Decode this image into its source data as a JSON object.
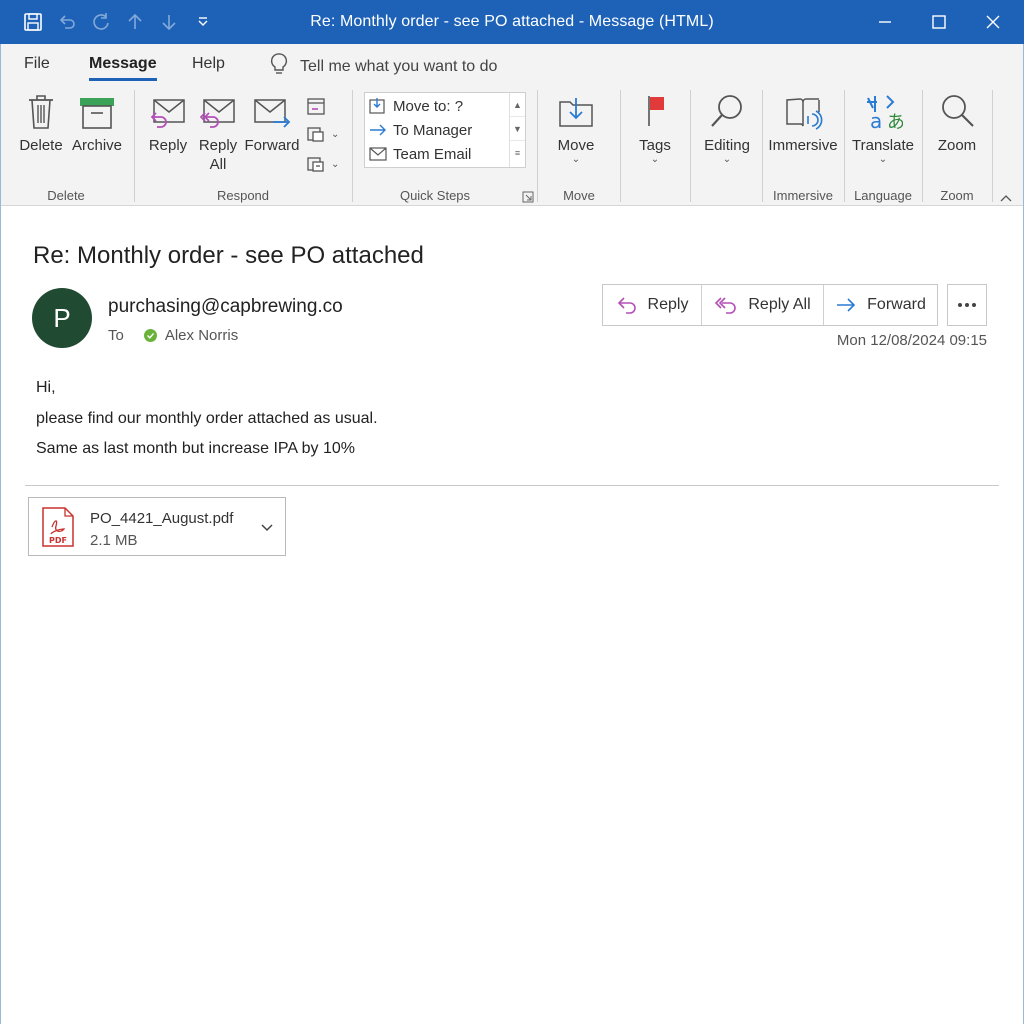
{
  "window": {
    "title": "Re: Monthly order - see PO attached  - Message (HTML)",
    "accent": "#1e62b8"
  },
  "menu": {
    "tabs": [
      "File",
      "Message",
      "Help"
    ],
    "active_tab": "Message",
    "tell_me": "Tell me what you want to do"
  },
  "ribbon": {
    "delete_group": {
      "label": "Delete",
      "delete": "Delete",
      "archive": "Archive"
    },
    "respond_group": {
      "label": "Respond",
      "reply": "Reply",
      "reply_all_1": "Reply",
      "reply_all_2": "All",
      "forward": "Forward"
    },
    "quick_steps": {
      "label": "Quick Steps",
      "items": [
        "Move to: ?",
        "To Manager",
        "Team Email"
      ]
    },
    "move_group": {
      "label": "Move",
      "move": "Move"
    },
    "tags": {
      "label": "Tags"
    },
    "editing": {
      "label": "Editing"
    },
    "immersive_group": {
      "label": "Immersive",
      "button": "Immersive"
    },
    "language_group": {
      "label": "Language",
      "button": "Translate"
    },
    "zoom_group": {
      "label": "Zoom",
      "button": "Zoom"
    }
  },
  "message": {
    "subject": "Re: Monthly order - see PO attached",
    "avatar_initial": "P",
    "avatar_color": "#214a32",
    "sender": "purchasing@capbrewing.co",
    "to_label": "To",
    "recipient": "Alex Norris",
    "date": "Mon 12/08/2024 09:15",
    "actions": {
      "reply": "Reply",
      "reply_all": "Reply All",
      "forward": "Forward"
    },
    "body": [
      "Hi,",
      "please find our monthly order attached as usual.",
      "Same as last month but increase IPA by 10%"
    ]
  },
  "attachment": {
    "name": "PO_4421_August.pdf",
    "size": "2.1 MB",
    "icon_label": "PDF"
  }
}
